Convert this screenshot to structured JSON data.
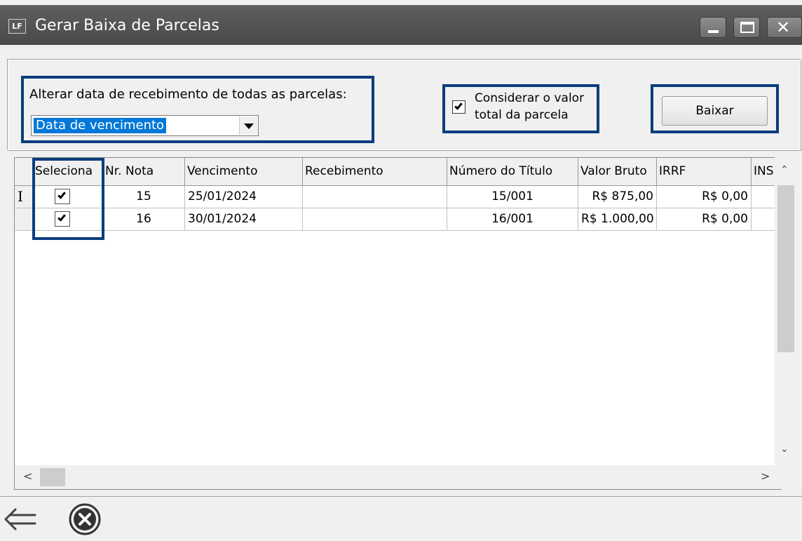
{
  "window": {
    "app_icon": "LF",
    "title": "Gerar Baixa de Parcelas"
  },
  "options": {
    "date_label": "Alterar data de recebimento de todas as parcelas:",
    "date_mode_value": "Data de vencimento",
    "consider_total_line1": "Considerar o valor",
    "consider_total_line2": "total da parcela",
    "consider_total_checked": true,
    "baixar_label": "Baixar"
  },
  "grid": {
    "columns": [
      "Seleciona",
      "Nr. Nota",
      "Vencimento",
      "Recebimento",
      "Número do Título",
      "Valor Bruto",
      "IRRF",
      "INS"
    ],
    "rows": [
      {
        "selected": true,
        "nr_nota": "15",
        "vencimento": "25/01/2024",
        "recebimento": "",
        "numero_titulo": "15/001",
        "valor_bruto": "R$ 875,00",
        "irrf": "R$ 0,00"
      },
      {
        "selected": true,
        "nr_nota": "16",
        "vencimento": "30/01/2024",
        "recebimento": "",
        "numero_titulo": "16/001",
        "valor_bruto": "R$ 1.000,00",
        "irrf": "R$ 0,00"
      }
    ]
  },
  "icons": {
    "back": "back-arrow-icon",
    "cancel": "cancel-circle-icon"
  },
  "colors": {
    "titlebar": "#4f4f4f",
    "highlight": "#0b3d7e",
    "selection": "#0078d7"
  }
}
